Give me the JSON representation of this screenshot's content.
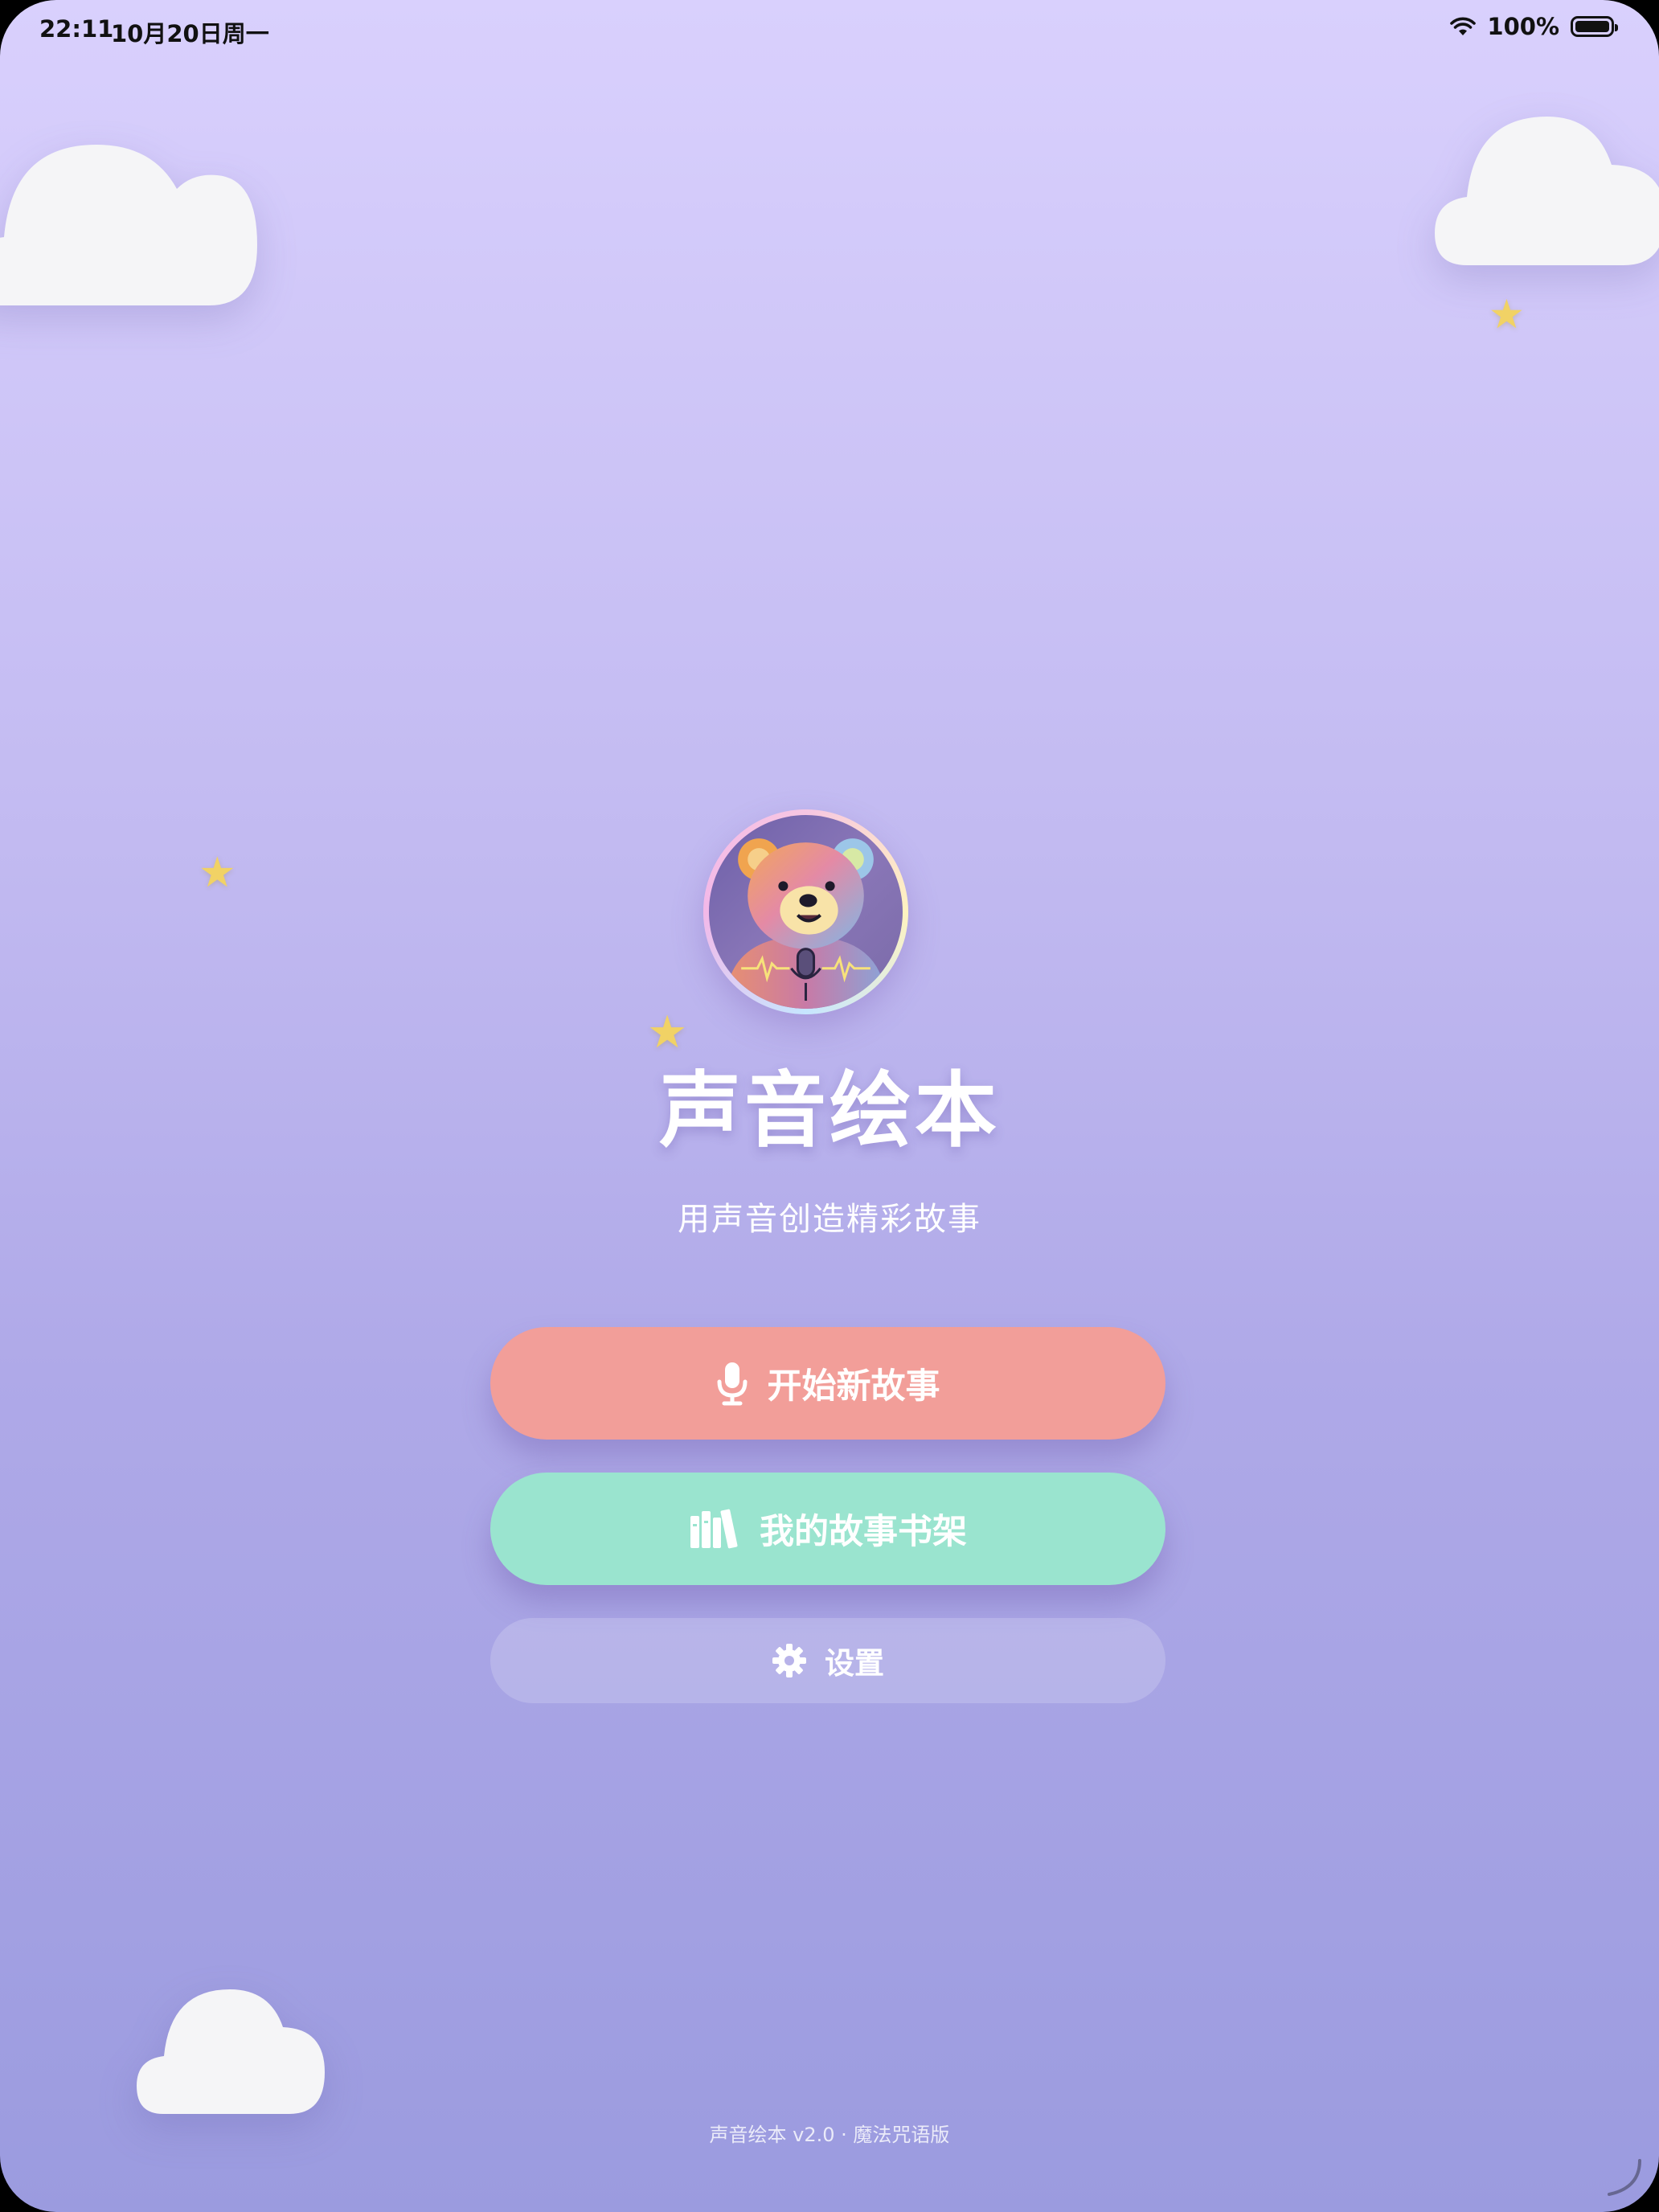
{
  "status_bar": {
    "time": "22:11",
    "date": "10月20日周一",
    "battery": "100%",
    "battery_level": 1.0
  },
  "app": {
    "title": "声音绘本",
    "subtitle": "用声音创造精彩故事",
    "logo_icon": "bear-with-microphone-icon"
  },
  "buttons": {
    "start_label": "开始新故事",
    "start_icon": "microphone-icon",
    "shelf_label": "我的故事书架",
    "shelf_icon": "bookshelf-icon",
    "settings_label": "设置",
    "settings_icon": "gear-icon"
  },
  "footer": {
    "text": "声音绘本 v2.0 · 魔法咒语版"
  },
  "colors": {
    "background_top": "#d9d0fd",
    "background_bottom": "#9b9bdf",
    "start_button": "#f29e99",
    "shelf_button": "#9ae4cf",
    "star": "#f1d265",
    "cloud": "#f5f5f7"
  }
}
